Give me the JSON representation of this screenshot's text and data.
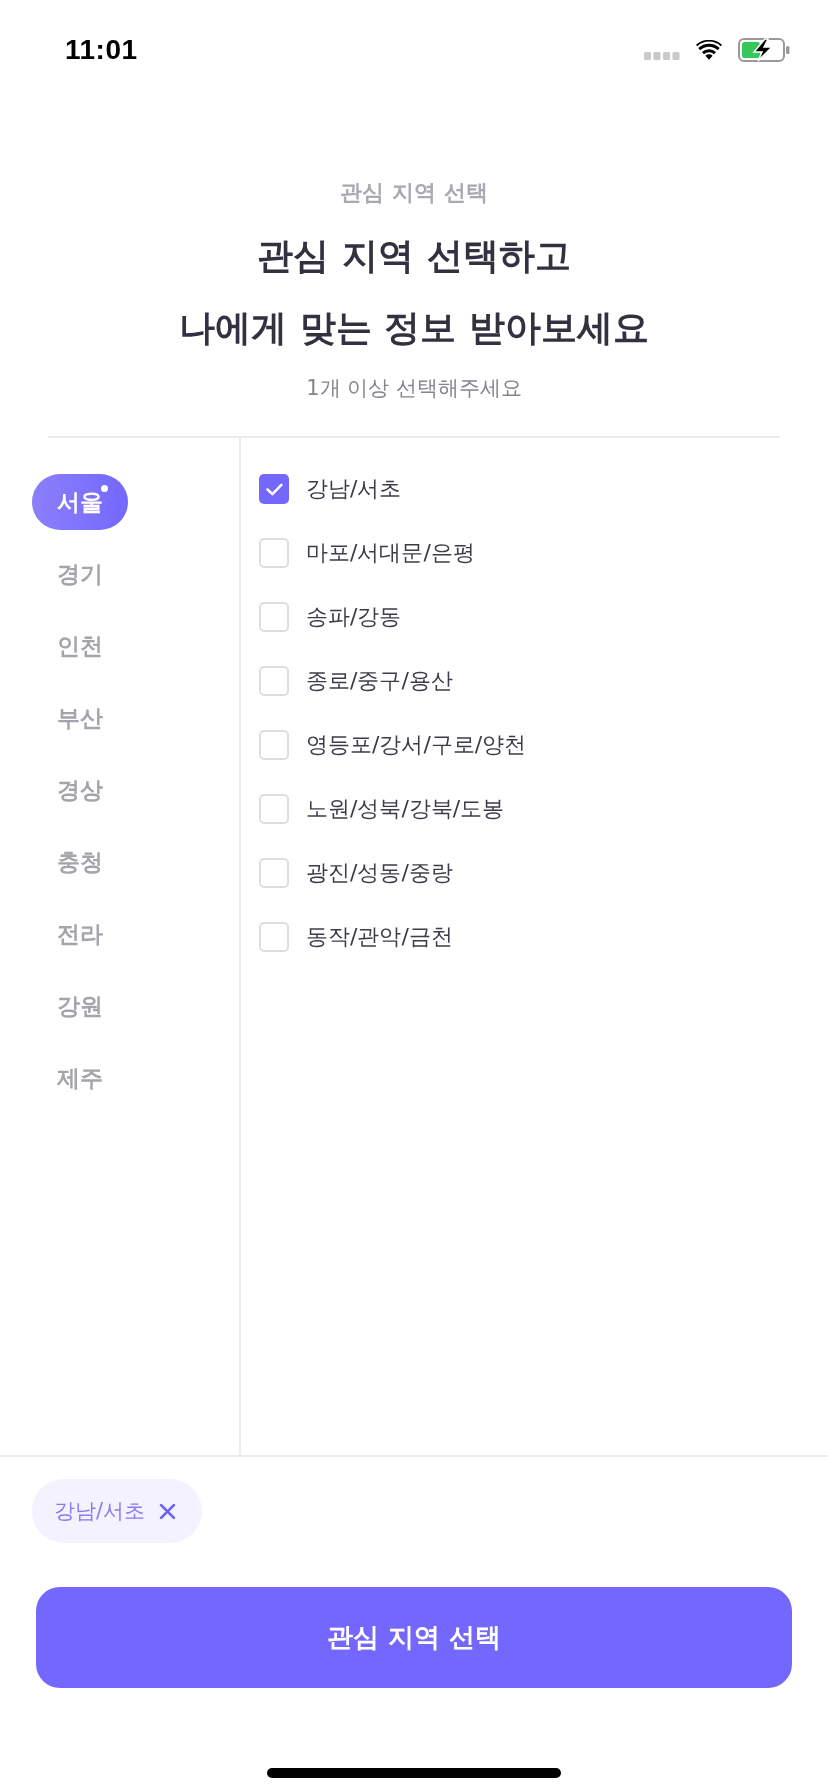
{
  "status_bar": {
    "time": "11:01"
  },
  "header": {
    "eyebrow": "관심 지역 선택",
    "title_lines": [
      "관심 지역 선택하고",
      "나에게 맞는 정보 받아보세요"
    ],
    "hint": "1개 이상 선택해주세요"
  },
  "regions": [
    {
      "label": "서울",
      "selected": true,
      "has_selection": true
    },
    {
      "label": "경기",
      "selected": false,
      "has_selection": false
    },
    {
      "label": "인천",
      "selected": false,
      "has_selection": false
    },
    {
      "label": "부산",
      "selected": false,
      "has_selection": false
    },
    {
      "label": "경상",
      "selected": false,
      "has_selection": false
    },
    {
      "label": "충청",
      "selected": false,
      "has_selection": false
    },
    {
      "label": "전라",
      "selected": false,
      "has_selection": false
    },
    {
      "label": "강원",
      "selected": false,
      "has_selection": false
    },
    {
      "label": "제주",
      "selected": false,
      "has_selection": false
    }
  ],
  "districts": [
    {
      "label": "강남/서초",
      "checked": true
    },
    {
      "label": "마포/서대문/은평",
      "checked": false
    },
    {
      "label": "송파/강동",
      "checked": false
    },
    {
      "label": "종로/중구/용산",
      "checked": false
    },
    {
      "label": "영등포/강서/구로/양천",
      "checked": false
    },
    {
      "label": "노원/성북/강북/도봉",
      "checked": false
    },
    {
      "label": "광진/성동/중랑",
      "checked": false
    },
    {
      "label": "동작/관악/금천",
      "checked": false
    }
  ],
  "selected_chips": [
    {
      "label": "강남/서초"
    }
  ],
  "submit_button": {
    "label": "관심 지역 선택"
  }
}
